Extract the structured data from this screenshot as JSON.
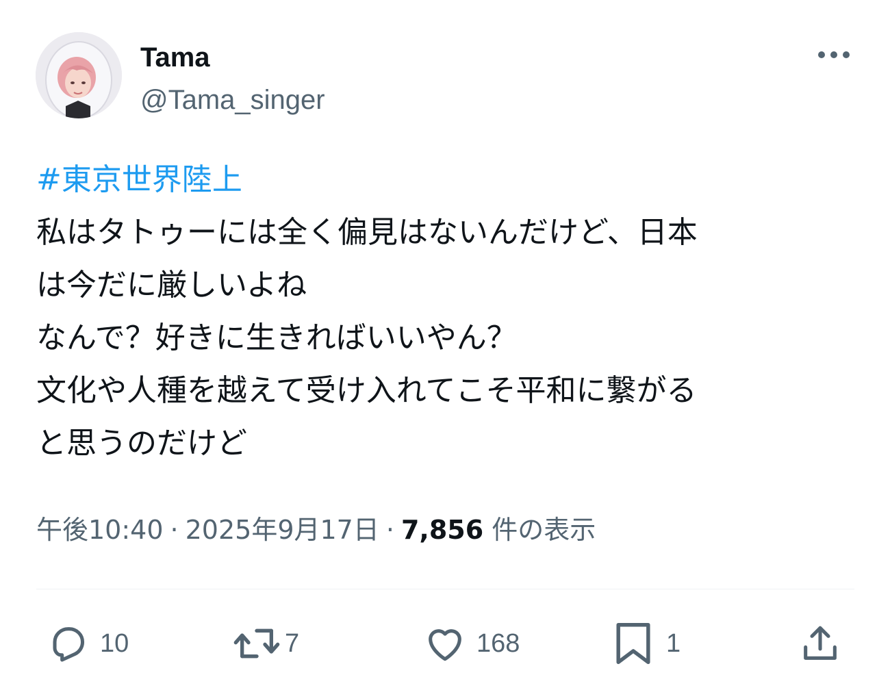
{
  "user": {
    "display_name": "Tama",
    "handle": "@Tama_singer"
  },
  "tweet": {
    "hashtag": "#東京世界陸上",
    "lines": [
      "私はタトゥーには全く偏見はないんだけど、日本",
      "は今だに厳しいよね",
      "なんで？好きに生きればいいやん？",
      "文化や人種を越えて受け入れてこそ平和に繋がる",
      "と思うのだけど"
    ]
  },
  "meta": {
    "time": "午後10:40",
    "separator": "·",
    "date": "2025年9月17日",
    "views_count": "7,856",
    "views_label": "件の表示"
  },
  "actions": {
    "replies": "10",
    "reposts": "7",
    "likes": "168",
    "bookmarks": "1"
  },
  "icons": {
    "more": "more-horizontal-icon",
    "reply": "reply-icon",
    "repost": "repost-icon",
    "like": "heart-icon",
    "bookmark": "bookmark-icon",
    "share": "share-icon"
  },
  "colors": {
    "text": "#0f1419",
    "secondary": "#536471",
    "link": "#1d9bf0",
    "divider": "#eff3f4"
  }
}
